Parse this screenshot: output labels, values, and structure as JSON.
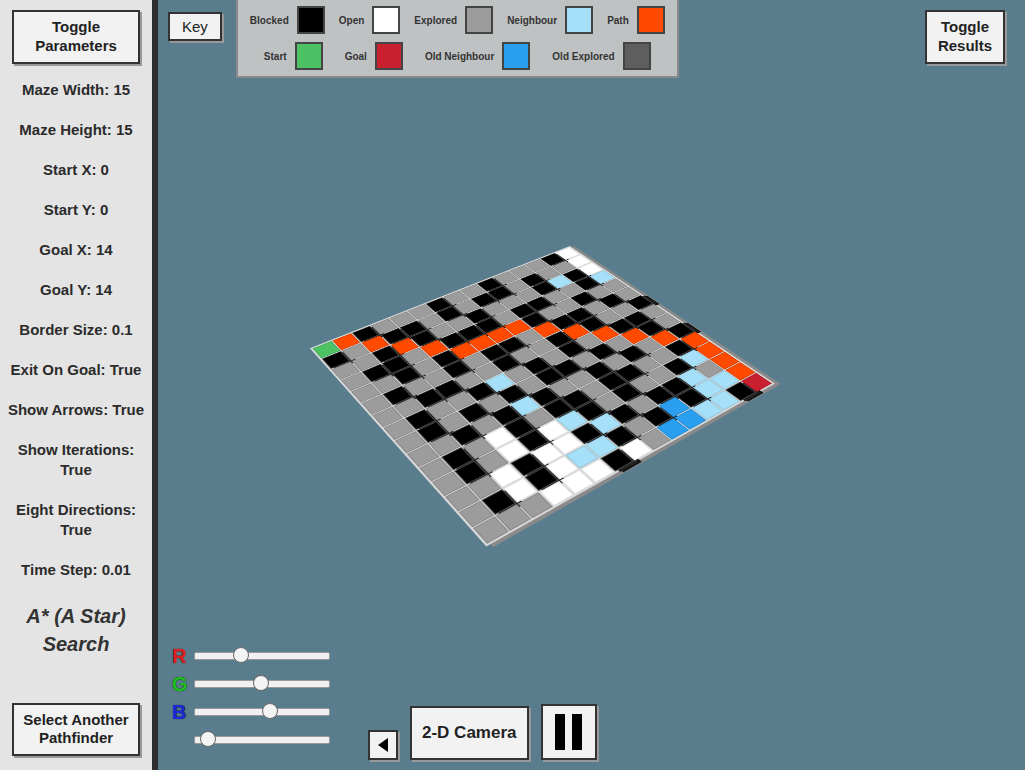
{
  "sidebar": {
    "toggle_button": "Toggle Parameters",
    "params": [
      "Maze Width: 15",
      "Maze Height: 15",
      "Start X: 0",
      "Start Y: 0",
      "Goal X: 14",
      "Goal Y: 14",
      "Border Size: 0.1",
      "Exit On Goal: True",
      "Show Arrows: True",
      "Show Iterations: True",
      "Eight Directions: True",
      "Time Step: 0.01"
    ],
    "algorithm": "A* (A Star) Search",
    "select_button": "Select Another Pathfinder"
  },
  "key_button": "Key",
  "legend_rows": [
    [
      {
        "label": "Blocked",
        "code": "#",
        "color": "#000000"
      },
      {
        "label": "Open",
        "code": ".",
        "color": "#ffffff"
      },
      {
        "label": "Explored",
        "code": "e",
        "color": "#9c9c9c"
      },
      {
        "label": "Neighbour",
        "code": "n",
        "color": "#a6e0f8"
      },
      {
        "label": "Path",
        "code": "p",
        "color": "#ff4a00"
      }
    ],
    [
      {
        "label": "Start",
        "code": "S",
        "color": "#4cc264"
      },
      {
        "label": "Goal",
        "code": "G",
        "color": "#c8202e"
      },
      {
        "label": "Old Neighbour",
        "code": "N",
        "color": "#2a9ff0"
      },
      {
        "label": "Old Explored",
        "code": "E",
        "color": "#5e5e5e"
      }
    ]
  ],
  "results_button": "Toggle Results",
  "maze": {
    "rows": [
      "Sp#eee#ee#eee#.",
      "#ep##e#e##e#ee.",
      "ee#p#ee#eee#n#.",
      "e##ep###e##ee#n",
      "ee#e#pppp#ee#ee",
      "e#ee#e##ep##e#e",
      "ee##ee#ee#p#ee#",
      "e#ee#ne#e#ep##e",
      "e#e#e#e##e#ep#e",
      "ee#e#n#ee#e#ep#",
      "e#e.#e##e##ee#p",
      "e#e.#.n#e#ee#np",
      "ee.#..#n#e##nep",
      "e#.#.nn#e#N#nnp",
      "eee...#.eNNnn#G"
    ]
  },
  "sliders": [
    {
      "label": "R",
      "color": "#e02020",
      "level": 0.34
    },
    {
      "label": "G",
      "color": "#20c020",
      "level": 0.49
    },
    {
      "label": "B",
      "color": "#1a2ad8",
      "level": 0.56
    },
    {
      "label": "",
      "color": "#ffffff",
      "level": 0.1
    }
  ],
  "camera_button": "2-D Camera"
}
